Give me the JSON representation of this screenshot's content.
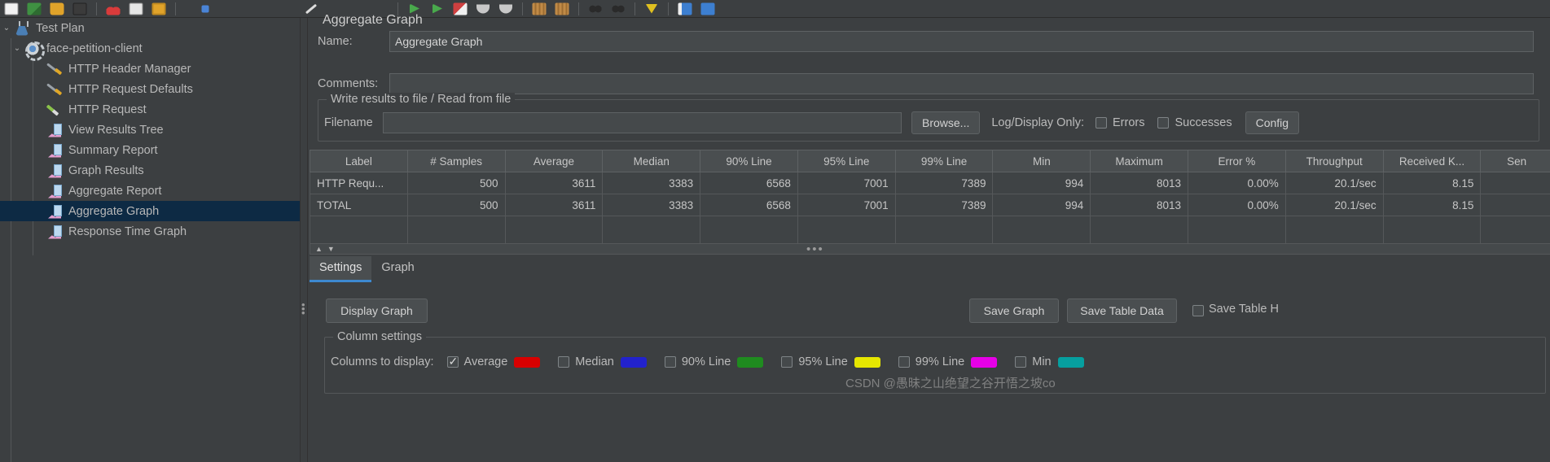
{
  "toolbar": {
    "icons": [
      {
        "name": "new-icon",
        "color": "#f2f2f2"
      },
      {
        "name": "open-template-icon",
        "color": "#3f9142"
      },
      {
        "name": "open-folder-icon",
        "color": "#e0a32a"
      },
      {
        "name": "save-icon",
        "color": "#3f3f3f"
      },
      {
        "name": "cut-icon",
        "color": "#d93b3b"
      },
      {
        "name": "copy-icon",
        "color": "#e6e6e6"
      },
      {
        "name": "paste-icon",
        "color": "#e0a32a"
      },
      {
        "name": "expand-icon",
        "color": "#4a84d6"
      },
      {
        "name": "toggle-icon",
        "color": "#dcdcdc"
      },
      {
        "name": "start-icon",
        "color": "#49a94c"
      },
      {
        "name": "start-no-timers-icon",
        "color": "#49a94c"
      },
      {
        "name": "remote-start-icon",
        "color": "#cf4040"
      },
      {
        "name": "stop-icon",
        "color": "#c8c8c8"
      },
      {
        "name": "shutdown-icon",
        "color": "#c8c8c8"
      },
      {
        "name": "clear-icon",
        "color": "#c08a46"
      },
      {
        "name": "clear-all-icon",
        "color": "#c08a46"
      },
      {
        "name": "search-icon",
        "color": "#3a3a3a"
      },
      {
        "name": "reset-search-icon",
        "color": "#3a3a3a"
      },
      {
        "name": "function-helper-icon",
        "color": "#e0c020"
      },
      {
        "name": "templates-icon",
        "color": "#3d7fd0"
      },
      {
        "name": "help-icon",
        "color": "#4a84d6"
      }
    ]
  },
  "tree": {
    "items": [
      {
        "label": "Test Plan",
        "icon": "test-plan-flask-icon",
        "indent": 0,
        "twisty": "expanded",
        "selected": false
      },
      {
        "label": "face-petition-client",
        "icon": "thread-group-gear-icon",
        "indent": 1,
        "twisty": "expanded",
        "selected": false
      },
      {
        "label": "HTTP Header Manager",
        "icon": "config-wrench-icon",
        "indent": 2,
        "twisty": "none",
        "selected": false
      },
      {
        "label": "HTTP Request Defaults",
        "icon": "config-wrench-icon",
        "indent": 2,
        "twisty": "none",
        "selected": false
      },
      {
        "label": "HTTP Request",
        "icon": "sampler-pen-icon",
        "indent": 2,
        "twisty": "none",
        "selected": false
      },
      {
        "label": "View Results Tree",
        "icon": "listener-chart-icon",
        "indent": 2,
        "twisty": "none",
        "selected": false
      },
      {
        "label": "Summary Report",
        "icon": "listener-chart-icon",
        "indent": 2,
        "twisty": "none",
        "selected": false
      },
      {
        "label": "Graph Results",
        "icon": "listener-chart-icon",
        "indent": 2,
        "twisty": "none",
        "selected": false
      },
      {
        "label": "Aggregate Report",
        "icon": "listener-chart-icon",
        "indent": 2,
        "twisty": "none",
        "selected": false
      },
      {
        "label": "Aggregate Graph",
        "icon": "listener-chart-icon",
        "indent": 2,
        "twisty": "none",
        "selected": true
      },
      {
        "label": "Response Time Graph",
        "icon": "listener-chart-icon",
        "indent": 2,
        "twisty": "none",
        "selected": false
      }
    ]
  },
  "panel": {
    "title": "Aggregate Graph",
    "name_label": "Name:",
    "name_value": "Aggregate Graph",
    "comments_label": "Comments:",
    "comments_value": "",
    "write_group_title": "Write results to file / Read from file",
    "filename_label": "Filename",
    "filename_value": "",
    "browse_label": "Browse...",
    "log_display_label": "Log/Display Only:",
    "errors_label": "Errors",
    "errors_checked": false,
    "successes_label": "Successes",
    "successes_checked": false,
    "configure_label": "Config"
  },
  "table": {
    "columns": [
      "Label",
      "# Samples",
      "Average",
      "Median",
      "90% Line",
      "95% Line",
      "99% Line",
      "Min",
      "Maximum",
      "Error %",
      "Throughput",
      "Received K...",
      "Sen"
    ],
    "rows": [
      [
        "HTTP Requ...",
        "500",
        "3611",
        "3383",
        "6568",
        "7001",
        "7389",
        "994",
        "8013",
        "0.00%",
        "20.1/sec",
        "8.15",
        ""
      ],
      [
        "TOTAL",
        "500",
        "3611",
        "3383",
        "6568",
        "7001",
        "7389",
        "994",
        "8013",
        "0.00%",
        "20.1/sec",
        "8.15",
        ""
      ]
    ]
  },
  "tabs": {
    "items": [
      {
        "label": "Settings",
        "active": true
      },
      {
        "label": "Graph",
        "active": false
      }
    ]
  },
  "settings": {
    "display_graph_label": "Display Graph",
    "save_graph_label": "Save Graph",
    "save_table_data_label": "Save Table Data",
    "save_table_header_label": "Save Table H",
    "save_table_header_checked": false,
    "column_settings_title": "Column settings",
    "columns_to_display_label": "Columns to display:",
    "columns": [
      {
        "label": "Average",
        "checked": true,
        "color": "#d80000"
      },
      {
        "label": "Median",
        "checked": false,
        "color": "#2222cc"
      },
      {
        "label": "90% Line",
        "checked": false,
        "color": "#1f8b1f"
      },
      {
        "label": "95% Line",
        "checked": false,
        "color": "#e6e600"
      },
      {
        "label": "99% Line",
        "checked": false,
        "color": "#e600e6"
      },
      {
        "label": "Min",
        "checked": false,
        "color": "#00aaaa"
      }
    ]
  },
  "watermark": {
    "text": "CSDN @愚昧之山绝望之谷开悟之坡co"
  }
}
